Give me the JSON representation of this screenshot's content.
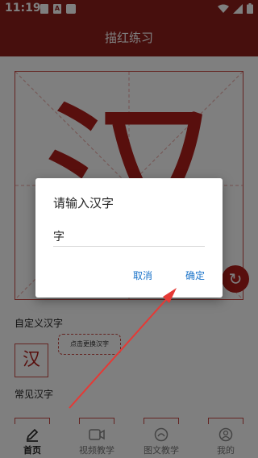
{
  "status_bar": {
    "time": "11:19",
    "icons": [
      "image-icon",
      "a-icon",
      "sim-icon"
    ]
  },
  "header": {
    "title": "描红练习"
  },
  "canvas": {
    "character": "汉"
  },
  "custom_section": {
    "label": "自定义汉字",
    "tile_char": "汉",
    "hint": "点击更换汉字"
  },
  "common_section": {
    "label": "常见汉字"
  },
  "dialog": {
    "title": "请输入汉字",
    "input_value": "字",
    "cancel": "取消",
    "confirm": "确定"
  },
  "tabs": [
    {
      "label": "首页",
      "icon": "pencil-icon",
      "active": true
    },
    {
      "label": "视频教学",
      "icon": "video-icon",
      "active": false
    },
    {
      "label": "图文教学",
      "icon": "book-icon",
      "active": false
    },
    {
      "label": "我的",
      "icon": "user-icon",
      "active": false
    }
  ],
  "colors": {
    "brand": "#8e1f1a",
    "accent": "#b01f1a",
    "link": "#1a73c9",
    "annotation": "#e53935"
  }
}
